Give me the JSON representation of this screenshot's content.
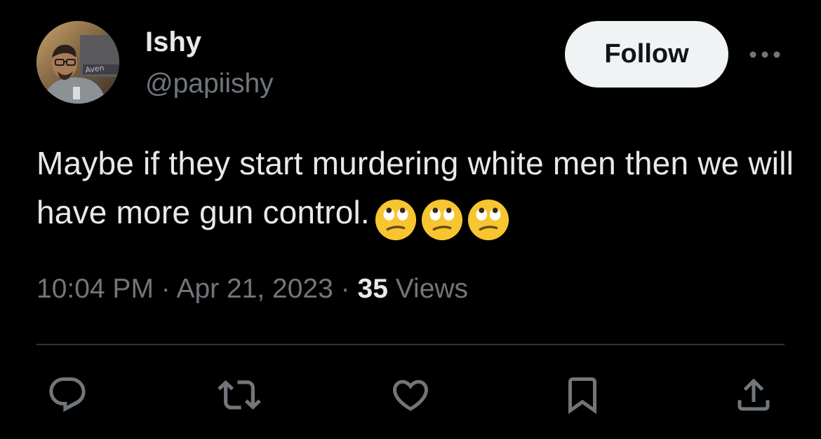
{
  "author": {
    "display_name": "Ishy",
    "handle": "@papiishy",
    "avatar_icon": "profile-photo"
  },
  "header": {
    "follow_label": "Follow",
    "more_icon": "ellipsis-icon"
  },
  "tweet": {
    "text": "Maybe if they start murdering white men then we will have more gun control.",
    "emojis": [
      "face-with-rolling-eyes",
      "face-with-rolling-eyes",
      "face-with-rolling-eyes"
    ]
  },
  "meta": {
    "time": "10:04 PM",
    "separator": "·",
    "date": "Apr 21, 2023",
    "views_count": "35",
    "views_label": "Views"
  },
  "actions": [
    {
      "icon": "reply-icon"
    },
    {
      "icon": "retweet-icon"
    },
    {
      "icon": "like-icon"
    },
    {
      "icon": "bookmark-icon"
    },
    {
      "icon": "share-icon"
    }
  ],
  "colors": {
    "background": "#000000",
    "primary_text": "#e7e9ea",
    "secondary_text": "#71767b",
    "divider": "#2f3336",
    "follow_button_bg": "#eff3f4",
    "follow_button_text": "#0f1419"
  }
}
